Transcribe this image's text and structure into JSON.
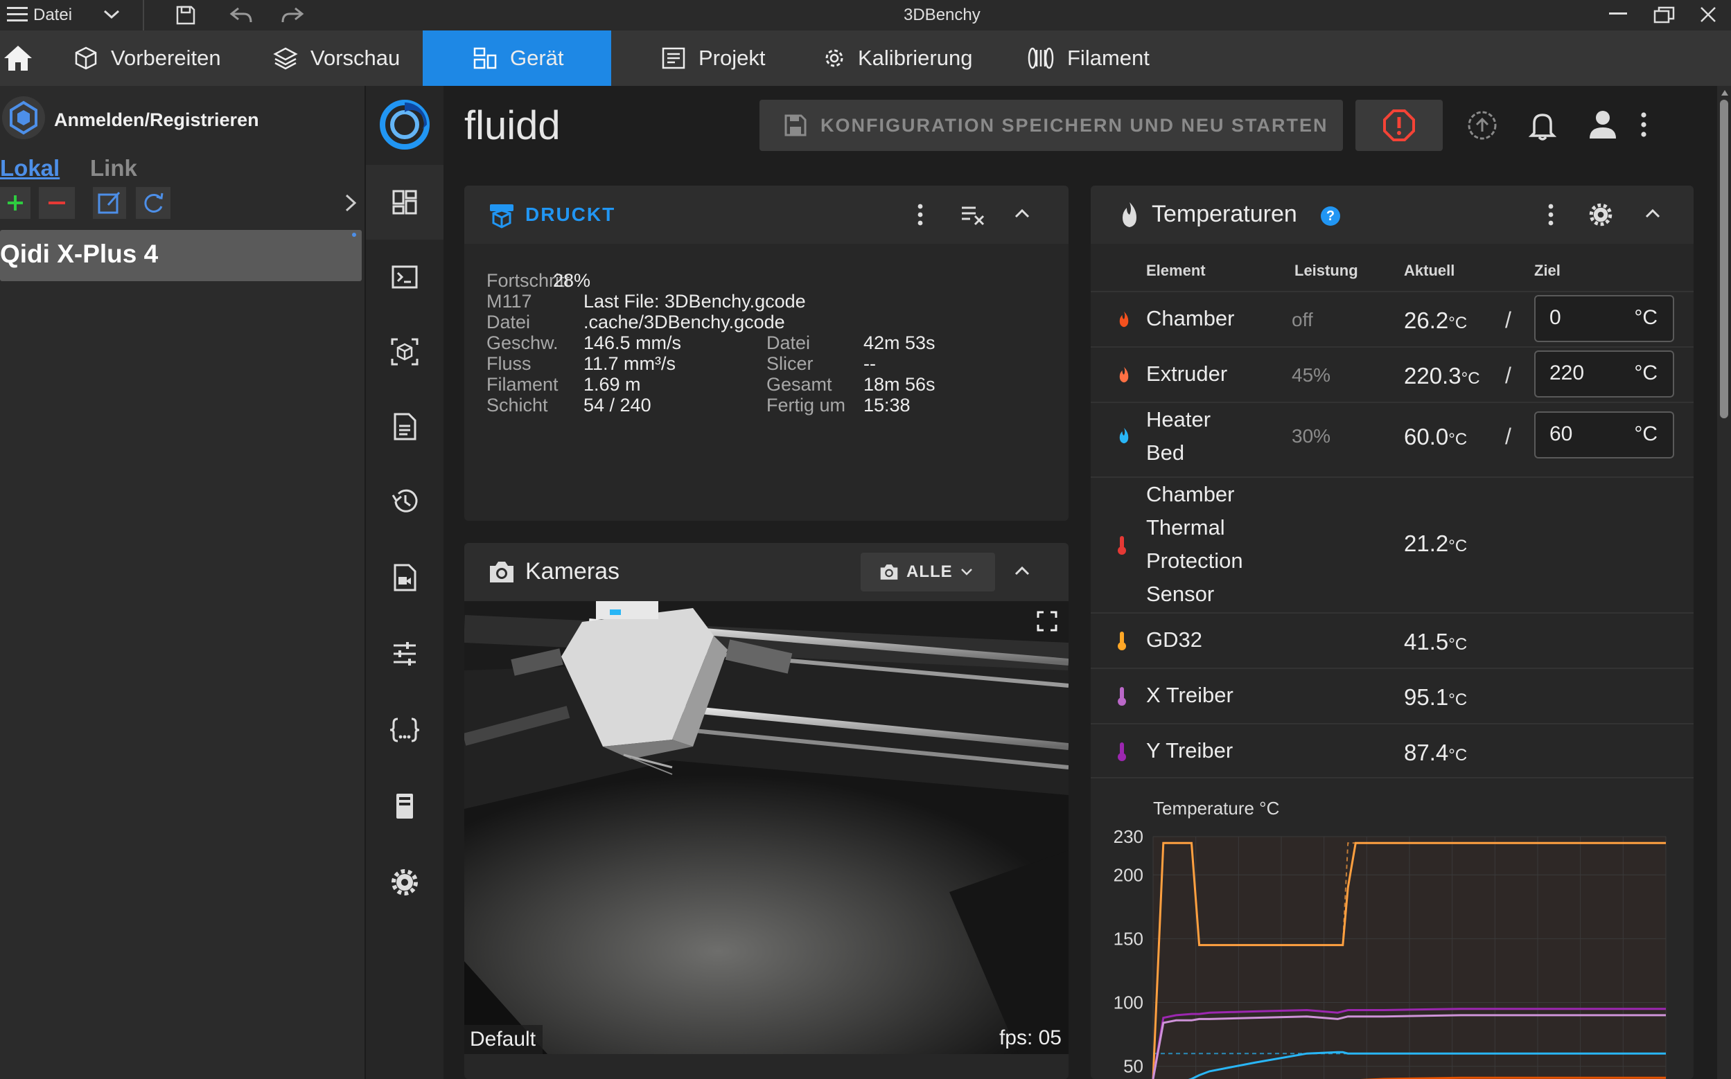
{
  "titlebar": {
    "menu_label": "Datei",
    "title": "3DBenchy"
  },
  "tabs": [
    {
      "label": "Vorbereiten"
    },
    {
      "label": "Vorschau"
    },
    {
      "label": "Gerät"
    },
    {
      "label": "Projekt"
    },
    {
      "label": "Kalibrierung"
    },
    {
      "label": "Filament"
    }
  ],
  "left_panel": {
    "login": "Anmelden/Registrieren",
    "tab_local": "Lokal",
    "tab_link": "Link",
    "printer": "Qidi X-Plus 4"
  },
  "header": {
    "brand": "fluidd",
    "save_restart": "KONFIGURATION SPEICHERN UND NEU STARTEN"
  },
  "print": {
    "status": "DRUCKT",
    "progress_label": "Fortschritt",
    "progress_value": "28%",
    "m117_label": "M117",
    "m117_value": "Last File: 3DBenchy.gcode",
    "file_label": "Datei",
    "file_value": ".cache/3DBenchy.gcode",
    "rows": [
      {
        "l1": "Geschw.",
        "v1": "146.5 mm/s",
        "l2": "Datei",
        "v2": "42m 53s"
      },
      {
        "l1": "Fluss",
        "v1": "11.7 mm³/s",
        "l2": "Slicer",
        "v2": "--"
      },
      {
        "l1": "Filament",
        "v1": "1.69 m",
        "l2": "Gesamt",
        "v2": "18m 56s"
      },
      {
        "l1": "Schicht",
        "v1": "54 / 240",
        "l2": "Fertig um",
        "v2": "15:38"
      }
    ]
  },
  "cameras": {
    "title": "Kameras",
    "all_button": "ALLE",
    "camera_name": "Default",
    "fps": "fps: 05"
  },
  "temperatures": {
    "title": "Temperaturen",
    "headers": {
      "element": "Element",
      "power": "Leistung",
      "current": "Aktuell",
      "target": "Ziel"
    },
    "unit": "°C",
    "rows": [
      {
        "name": "Chamber",
        "power": "off",
        "current": "26.2",
        "target": "0",
        "icon_color": "#f4511e"
      },
      {
        "name": "Extruder",
        "power": "45%",
        "current": "220.3",
        "target": "220",
        "icon_color": "#ff7043"
      },
      {
        "name": "Heater Bed",
        "power": "30%",
        "current": "60.0",
        "target": "60",
        "icon_color": "#29b6f6"
      },
      {
        "name": "Chamber Thermal Protection Sensor",
        "current": "21.2",
        "icon_color": "#e53935"
      },
      {
        "name": "GD32",
        "current": "41.5",
        "icon_color": "#ffa726"
      },
      {
        "name": "X Treiber",
        "current": "95.1",
        "icon_color": "#ba68c8"
      },
      {
        "name": "Y Treiber",
        "current": "87.4",
        "icon_color": "#9c27b0"
      }
    ]
  },
  "chart_data": {
    "type": "line",
    "title": "Temperature °C",
    "y_ticks": [
      230,
      200,
      150,
      100,
      50
    ],
    "ylim": [
      40,
      230
    ],
    "x": [
      0,
      0.02,
      0.045,
      0.075,
      0.09,
      0.11,
      0.2,
      0.3,
      0.36,
      0.37,
      0.38,
      0.395,
      0.45,
      0.6,
      0.8,
      1.0
    ],
    "series": [
      {
        "color": "#ffa040",
        "values": [
          40,
          225,
          225,
          225,
          145,
          145,
          145,
          145,
          145,
          145,
          190,
          225,
          225,
          225,
          225,
          225
        ]
      },
      {
        "color": "#9c27b0",
        "values": [
          40,
          88,
          90,
          91,
          91,
          92,
          93,
          94,
          92,
          93,
          94,
          94,
          94,
          95,
          95,
          95
        ]
      },
      {
        "color": "#ce93d8",
        "values": [
          40,
          84,
          86,
          86,
          87,
          87,
          88,
          89,
          87,
          88,
          89,
          89,
          89,
          90,
          90,
          90
        ]
      },
      {
        "color": "#29b6f6",
        "values": [
          30,
          32,
          36,
          40,
          43,
          46,
          53,
          60,
          61,
          61,
          60,
          60,
          60,
          60,
          60,
          60
        ]
      },
      {
        "color": "#e65100",
        "values": [
          30,
          30,
          30,
          31,
          32,
          33,
          36,
          38,
          38,
          39,
          39,
          39,
          40,
          41,
          41,
          41
        ]
      }
    ],
    "targets": [
      {
        "color": "#ffa040",
        "values": [
          40,
          225,
          225,
          225,
          145,
          145,
          145,
          145,
          145,
          145,
          225,
          225,
          225,
          225,
          225,
          225
        ]
      },
      {
        "color": "#29b6f6",
        "values": [
          60,
          60,
          60,
          60,
          60,
          60,
          60,
          60,
          60,
          60,
          60,
          60,
          60,
          60,
          60,
          60
        ]
      }
    ]
  }
}
